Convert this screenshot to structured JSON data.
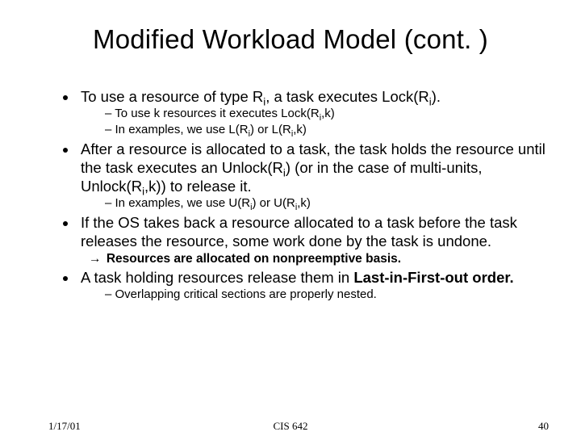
{
  "title": "Modified Workload Model (cont. )",
  "bullets": {
    "b1": {
      "pre": "To use a resource of type R",
      "post": ", a task executes Lock(R",
      "tail": ")."
    },
    "b1s1": {
      "pre": "To use k resources it executes Lock(R",
      "tail": ",k)"
    },
    "b1s2": {
      "pre": "In examples, we use L(R",
      "mid": ") or L(R",
      "tail": ",k)"
    },
    "b2": {
      "pre": "After a resource is allocated to a task, the task holds the resource until the task executes an Unlock(R",
      "mid": ") (or in the case of multi-units, Unlock(R",
      "tail": ",k)) to release it."
    },
    "b2s1": {
      "pre": "In examples, we use U(R",
      "mid": ") or U(R",
      "tail": ",k)"
    },
    "b3": "If the OS takes back a resource allocated to a task before the task releases the resource, some work done by the task is undone.",
    "b3arrow": "Resources are allocated on nonpreemptive basis.",
    "b4": {
      "pre": "A task holding resources release them in ",
      "bold": "Last-in-First-out order."
    },
    "b4s1": "Overlapping critical sections are properly nested."
  },
  "footer": {
    "date": "1/17/01",
    "course": "CIS 642",
    "page": "40"
  }
}
